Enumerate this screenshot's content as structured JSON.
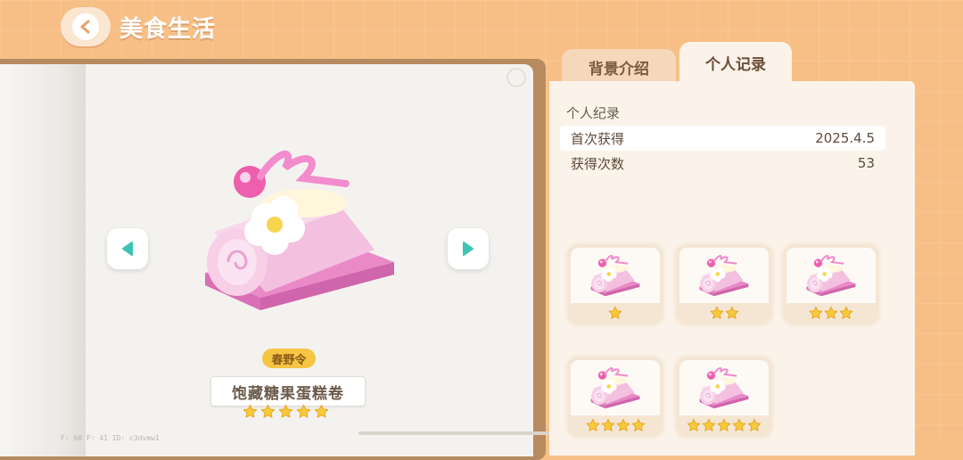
{
  "header": {
    "title": "美食生活"
  },
  "tabs": [
    {
      "label": "背景介绍",
      "active": false
    },
    {
      "label": "个人记录",
      "active": true
    }
  ],
  "item": {
    "badge": "春野令",
    "name": "饱藏糖果蛋糕卷",
    "stars": 5
  },
  "record": {
    "section_title": "个人纪录",
    "rows": [
      {
        "label": "首次获得",
        "value": "2025.4.5"
      },
      {
        "label": "获得次数",
        "value": "53"
      }
    ]
  },
  "variants": [
    {
      "stars": 1
    },
    {
      "stars": 2
    },
    {
      "stars": 3
    },
    {
      "stars": 4
    },
    {
      "stars": 5
    }
  ],
  "debug_text": "F: 60    F: 41    ID: c3dvmw1",
  "colors": {
    "background": "#f7bf86",
    "badge": "#f6c544",
    "star": "#f8c93a",
    "arrow": "#3fc3b6",
    "cake": "#f3b8dc"
  }
}
